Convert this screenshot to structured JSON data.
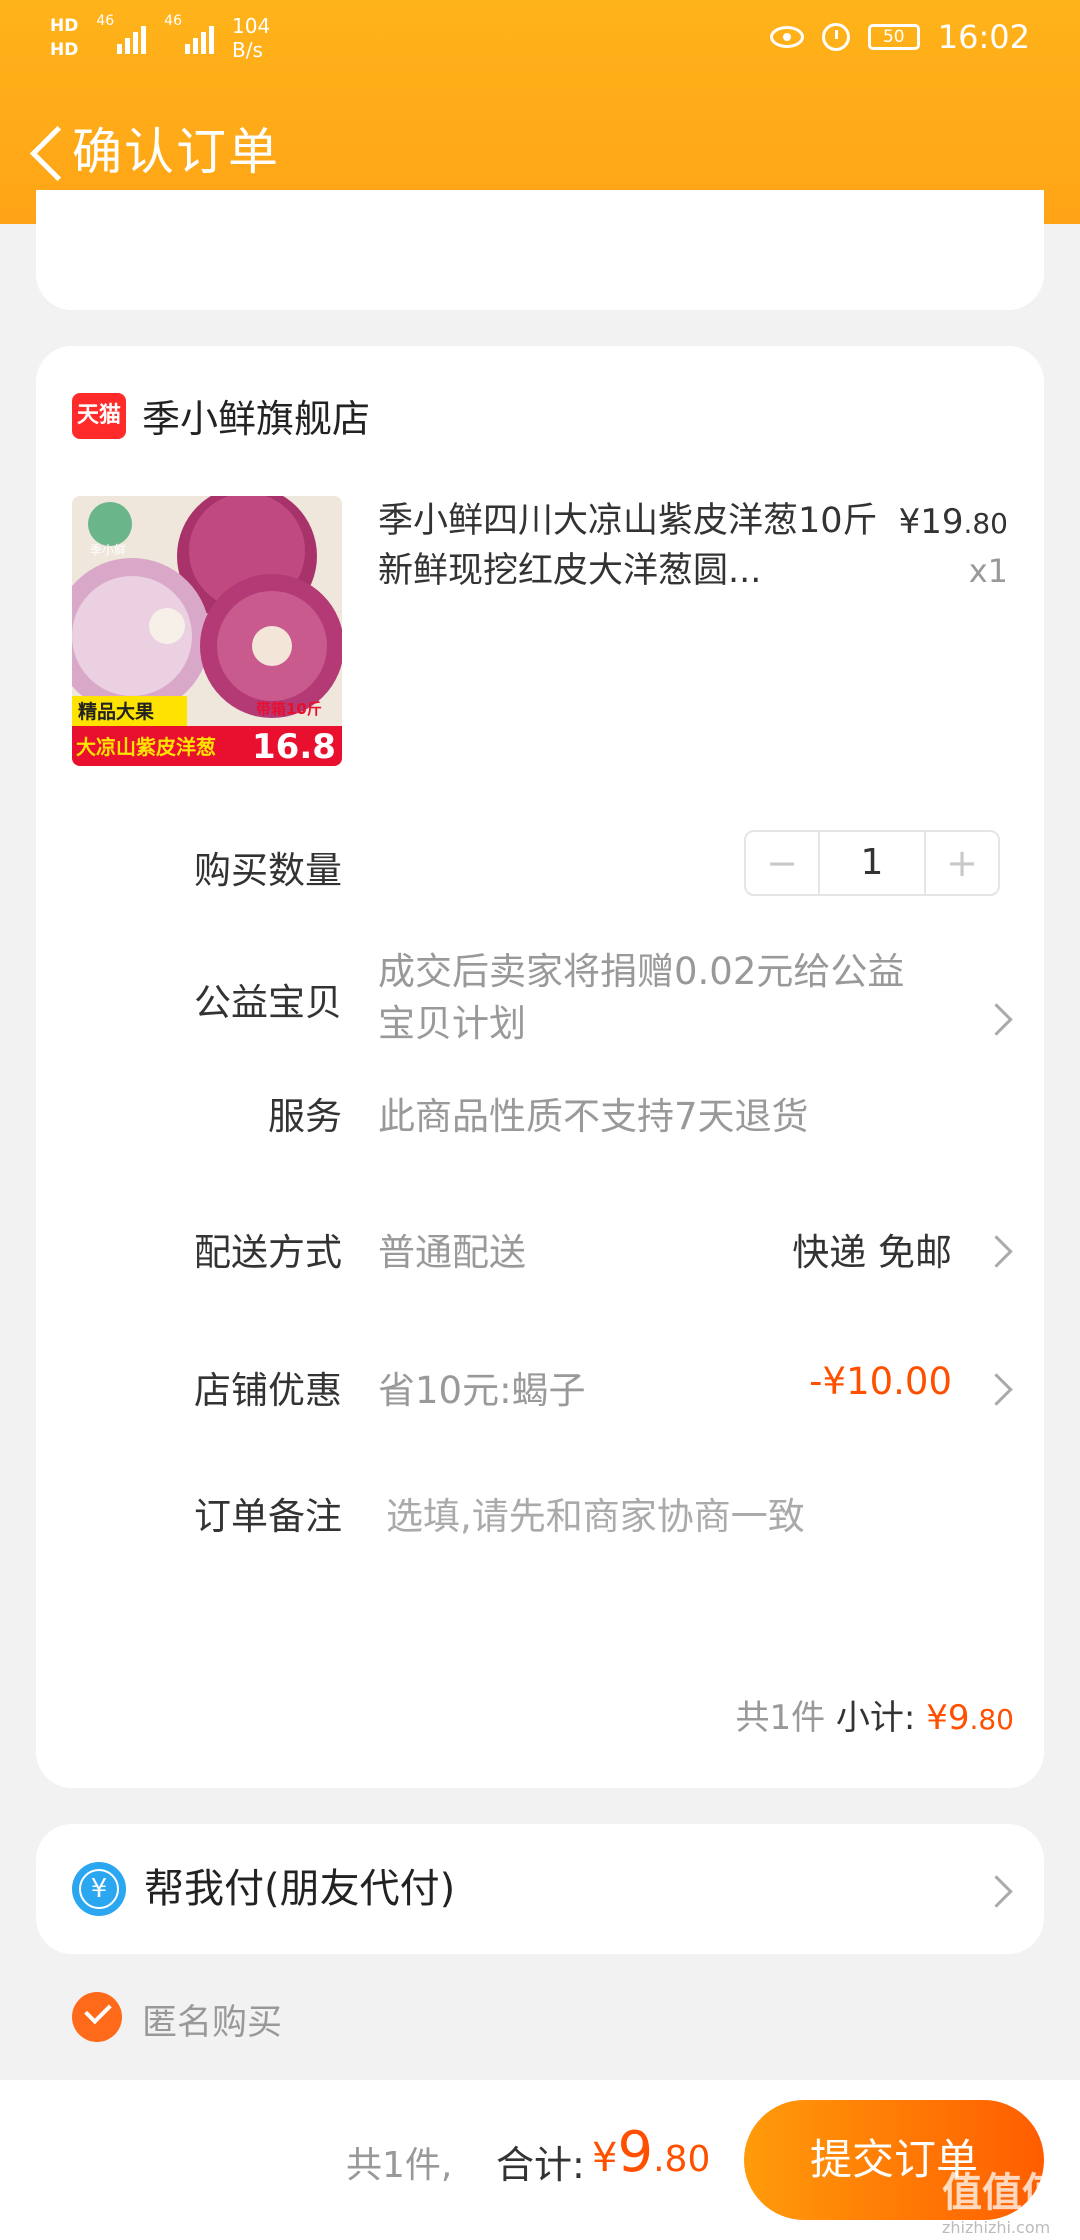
{
  "status_bar": {
    "hd1": "HD",
    "hd2": "HD",
    "net1": "46",
    "net2": "46",
    "speed_value": "104",
    "speed_unit": "B/s",
    "battery": "50",
    "time": "16:02"
  },
  "header": {
    "title": "确认订单"
  },
  "shop": {
    "badge": "天猫",
    "name": "季小鲜旗舰店"
  },
  "product": {
    "title": "季小鲜四川大凉山紫皮洋葱10斤新鲜现挖红皮大洋葱圆...",
    "price_symbol": "¥",
    "price_int": "19",
    "price_dec": ".80",
    "quantity": "x1",
    "image_texts": {
      "brand": "季小鲜",
      "tag1": "精品大果",
      "tag2": "带箱10斤",
      "banner": "大凉山紫皮洋葱",
      "banner_price": "16.8"
    }
  },
  "rows": {
    "qty_label": "购买数量",
    "qty_value": "1",
    "minus": "−",
    "plus": "+",
    "charity_label": "公益宝贝",
    "charity_value": "成交后卖家将捐赠0.02元给公益宝贝计划",
    "service_label": "服务",
    "service_value": "此商品性质不支持7天退货",
    "delivery_label": "配送方式",
    "delivery_value": "普通配送",
    "delivery_right": "快递 免邮",
    "discount_label": "店铺优惠",
    "discount_value": "省10元:蝎子",
    "discount_amount": "-¥10.00",
    "note_label": "订单备注",
    "note_placeholder": "选填,请先和商家协商一致"
  },
  "subtotal": {
    "count": "共1件",
    "label": "小计:",
    "symbol": "¥",
    "int": "9",
    "dec": ".80"
  },
  "pay_for_me": {
    "icon": "¥",
    "label": "帮我付(朋友代付)"
  },
  "anonymous": {
    "label": "匿名购买",
    "checked": true
  },
  "footer": {
    "count": "共1件,",
    "total_label": "合计:",
    "symbol": "¥",
    "total_int": "9",
    "total_dec": ".80",
    "submit": "提交订单"
  },
  "watermark": {
    "text": "值值值",
    "url": "zhizhizhi.com"
  },
  "colors": {
    "accent": "#ffa416",
    "price": "#ff5000",
    "submit_start": "#ff9b0a",
    "submit_end": "#ff5d00"
  }
}
